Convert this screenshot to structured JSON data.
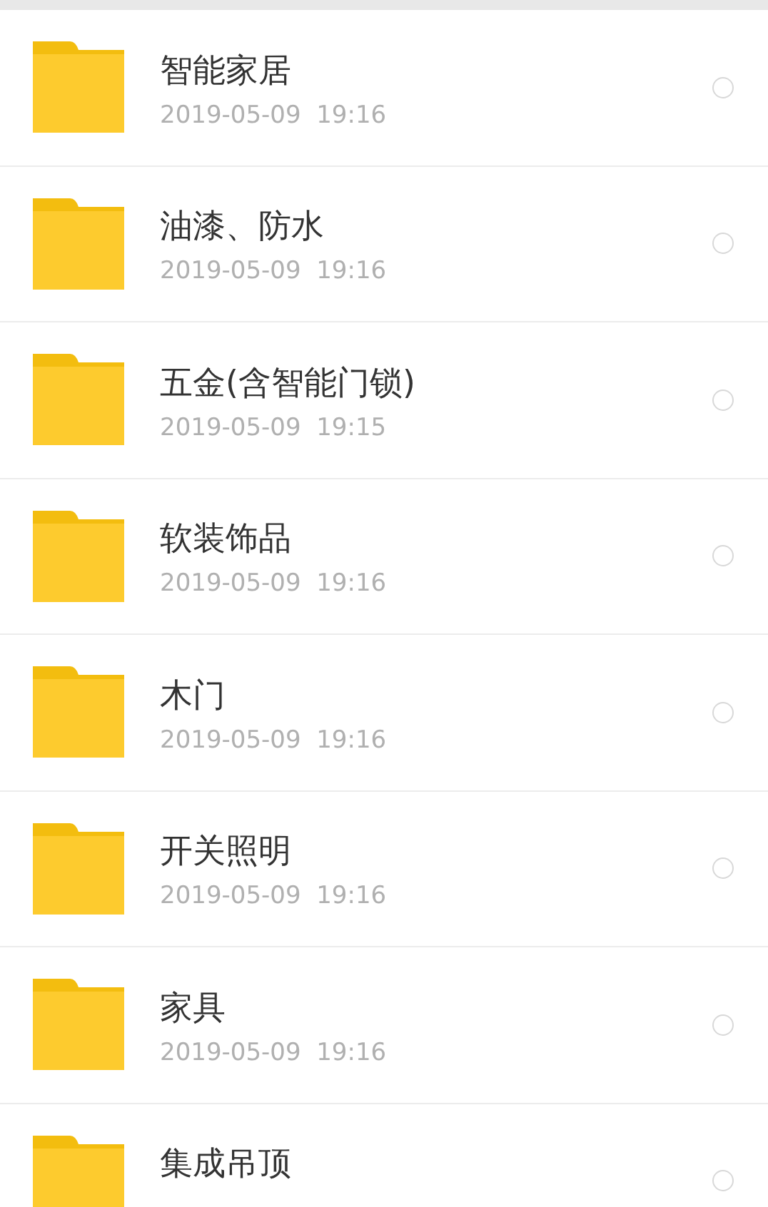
{
  "folders": [
    {
      "name": "智能家居",
      "date": "2019-05-09  19:16",
      "selected": false
    },
    {
      "name": "油漆、防水",
      "date": "2019-05-09  19:16",
      "selected": false
    },
    {
      "name": "五金(含智能门锁)",
      "date": "2019-05-09  19:15",
      "selected": false
    },
    {
      "name": "软装饰品",
      "date": "2019-05-09  19:16",
      "selected": false
    },
    {
      "name": "木门",
      "date": "2019-05-09  19:16",
      "selected": false
    },
    {
      "name": "开关照明",
      "date": "2019-05-09  19:16",
      "selected": false
    },
    {
      "name": "家具",
      "date": "2019-05-09  19:16",
      "selected": false
    },
    {
      "name": "集成吊顶",
      "selected": false
    }
  ]
}
